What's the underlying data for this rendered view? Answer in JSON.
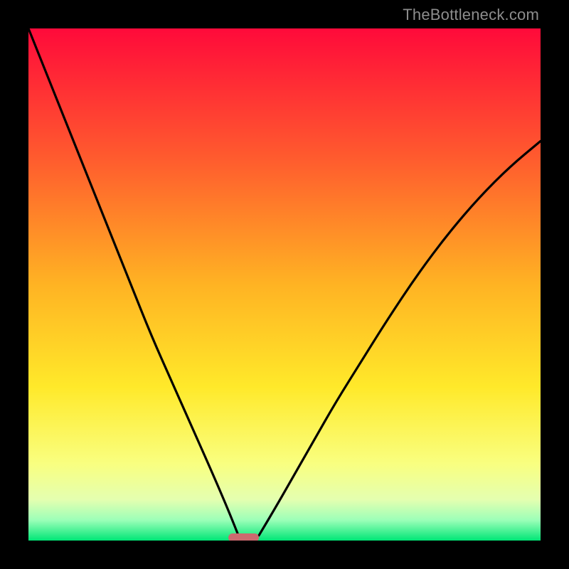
{
  "watermark": {
    "text": "TheBottleneck.com"
  },
  "chart_data": {
    "type": "line",
    "title": "",
    "xlabel": "",
    "ylabel": "",
    "xlim": [
      0,
      100
    ],
    "ylim": [
      0,
      100
    ],
    "grid": false,
    "legend": false,
    "background_gradient_stops": [
      {
        "offset": 0,
        "color": "#ff0a3a"
      },
      {
        "offset": 0.25,
        "color": "#ff5a2e"
      },
      {
        "offset": 0.5,
        "color": "#ffb323"
      },
      {
        "offset": 0.7,
        "color": "#ffe92a"
      },
      {
        "offset": 0.85,
        "color": "#f9ff80"
      },
      {
        "offset": 0.92,
        "color": "#e4ffb0"
      },
      {
        "offset": 0.96,
        "color": "#9cffb8"
      },
      {
        "offset": 1.0,
        "color": "#00e676"
      }
    ],
    "optimum_marker": {
      "x": 42,
      "width": 6,
      "color": "#cc6a6f"
    },
    "series": [
      {
        "name": "left-curve",
        "x": [
          0,
          4,
          8,
          12,
          16,
          20,
          24,
          28,
          32,
          36,
          39,
          41
        ],
        "y": [
          100,
          90,
          80,
          70,
          60,
          50,
          40,
          31,
          22,
          13,
          6,
          1
        ]
      },
      {
        "name": "right-curve",
        "x": [
          45,
          48,
          52,
          56,
          60,
          65,
          70,
          76,
          82,
          88,
          94,
          100
        ],
        "y": [
          1,
          6,
          13,
          20,
          27,
          35,
          43,
          52,
          60,
          67,
          73,
          78
        ]
      }
    ]
  }
}
